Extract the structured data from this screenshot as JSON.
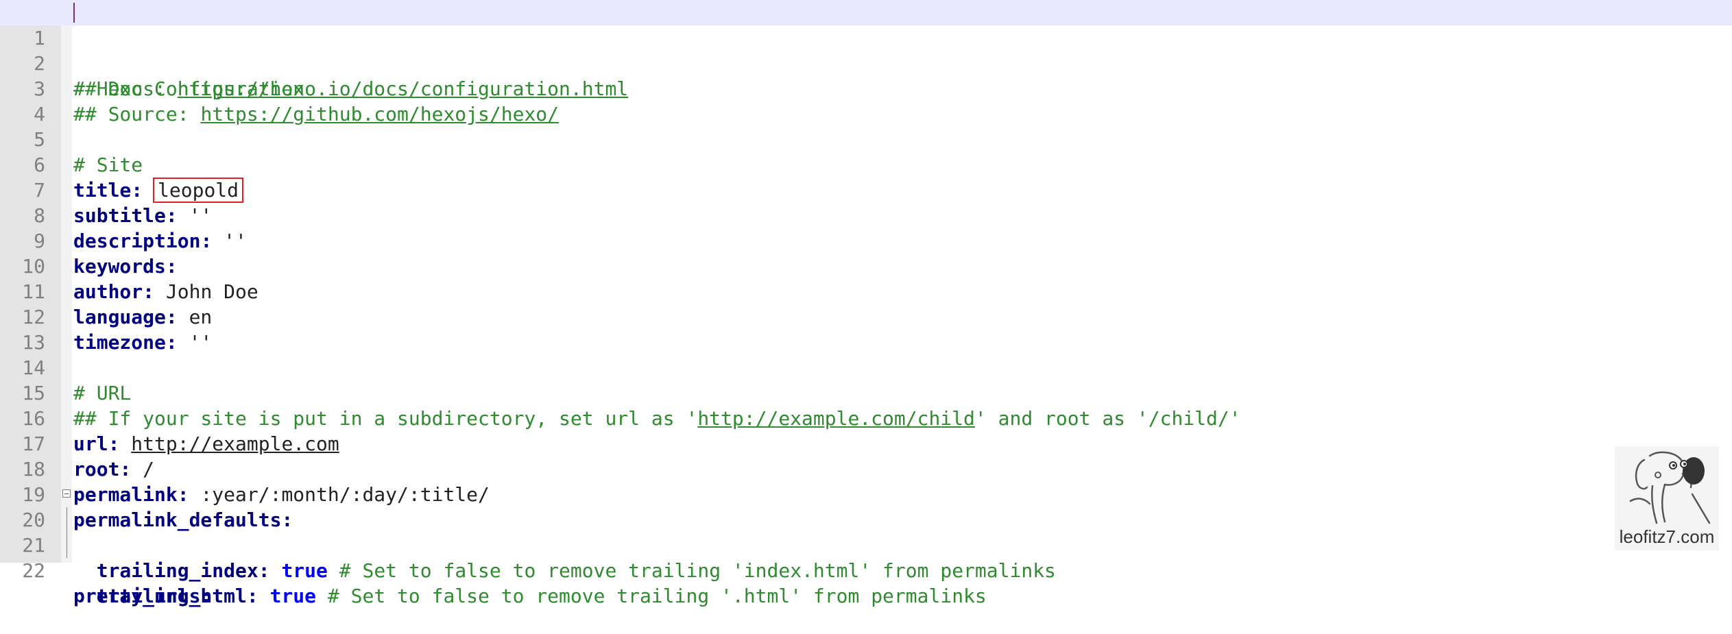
{
  "editor": {
    "lines": [
      {
        "n": "1",
        "text": "# Hexo Configuration"
      },
      {
        "n": "2",
        "prefix": "## Docs: ",
        "link": "https://hexo.io/docs/configuration.html"
      },
      {
        "n": "3",
        "prefix": "## Source: ",
        "link": "https://github.com/hexojs/hexo/"
      },
      {
        "n": "4"
      },
      {
        "n": "5",
        "text": "# Site"
      },
      {
        "n": "6",
        "key": "title",
        "value": "leopold"
      },
      {
        "n": "7",
        "key": "subtitle",
        "value": "''"
      },
      {
        "n": "8",
        "key": "description",
        "value": "''"
      },
      {
        "n": "9",
        "key": "keywords"
      },
      {
        "n": "10",
        "key": "author",
        "value": "John Doe"
      },
      {
        "n": "11",
        "key": "language",
        "value": "en"
      },
      {
        "n": "12",
        "key": "timezone",
        "value": "''"
      },
      {
        "n": "13"
      },
      {
        "n": "14",
        "text": "# URL"
      },
      {
        "n": "15",
        "prefix": "## If your site is put in a subdirectory, set url as '",
        "link": "http://example.com/child",
        "suffix": "' and root as '/child/'"
      },
      {
        "n": "16",
        "key": "url",
        "link": "http://example.com"
      },
      {
        "n": "17",
        "key": "root",
        "value": "/"
      },
      {
        "n": "18",
        "key": "permalink",
        "value": ":year/:month/:day/:title/"
      },
      {
        "n": "19",
        "key": "permalink_defaults"
      },
      {
        "n": "20",
        "key": "pretty_urls"
      },
      {
        "n": "21",
        "key": "trailing_index",
        "bool": "true",
        "comment": "# Set to false to remove trailing 'index.html' from permalinks"
      },
      {
        "n": "22",
        "key": "trailing_html",
        "bool": "true",
        "comment": "# Set to false to remove trailing '.html' from permalinks"
      }
    ]
  },
  "watermark": {
    "text": "leofitz7.com"
  },
  "colors": {
    "comment": "#2e8b2e",
    "key": "#000080",
    "bool": "#0000ff",
    "highlight_box": "#e02020",
    "current_line": "#e8e8ff"
  }
}
